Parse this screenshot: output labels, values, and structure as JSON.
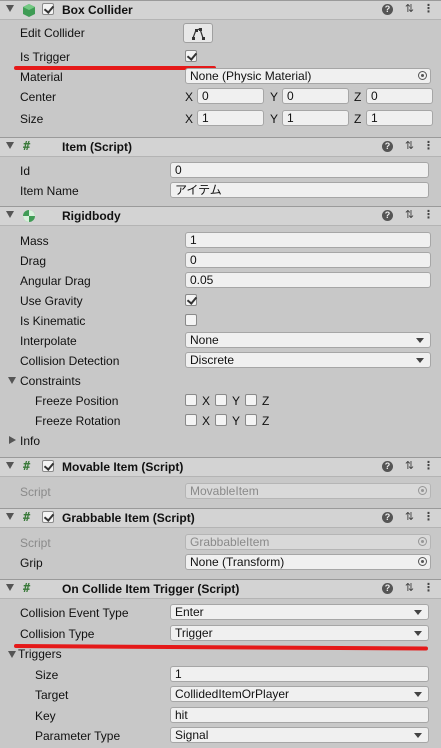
{
  "box_collider": {
    "title": "Box Collider",
    "edit_collider_label": "Edit Collider",
    "is_trigger_label": "Is Trigger",
    "material_label": "Material",
    "material_value": "None (Physic Material)",
    "center_label": "Center",
    "center": {
      "x": "0",
      "y": "0",
      "z": "0"
    },
    "size_label": "Size",
    "size": {
      "x": "1",
      "y": "1",
      "z": "1"
    }
  },
  "axes": {
    "x": "X",
    "y": "Y",
    "z": "Z"
  },
  "item_script": {
    "title": "Item (Script)",
    "id_label": "Id",
    "id_value": "0",
    "item_name_label": "Item Name",
    "item_name_value": "アイテム"
  },
  "rigidbody": {
    "title": "Rigidbody",
    "mass_label": "Mass",
    "mass_value": "1",
    "drag_label": "Drag",
    "drag_value": "0",
    "angular_drag_label": "Angular Drag",
    "angular_drag_value": "0.05",
    "use_gravity_label": "Use Gravity",
    "is_kinematic_label": "Is Kinematic",
    "interpolate_label": "Interpolate",
    "interpolate_value": "None",
    "collision_detection_label": "Collision Detection",
    "collision_detection_value": "Discrete",
    "constraints_label": "Constraints",
    "freeze_position_label": "Freeze Position",
    "freeze_rotation_label": "Freeze Rotation",
    "info_label": "Info"
  },
  "movable_item": {
    "title": "Movable Item (Script)",
    "script_label": "Script",
    "script_value": "MovableItem"
  },
  "grabbable_item": {
    "title": "Grabbable Item (Script)",
    "script_label": "Script",
    "script_value": "GrabbableItem",
    "grip_label": "Grip",
    "grip_value": "None (Transform)"
  },
  "on_collide": {
    "title": "On Collide Item Trigger (Script)",
    "collision_event_type_label": "Collision Event Type",
    "collision_event_type_value": "Enter",
    "collision_type_label": "Collision Type",
    "collision_type_value": "Trigger",
    "triggers_label": "Triggers",
    "size_label": "Size",
    "size_value": "1",
    "target_label": "Target",
    "target_value": "CollidedItemOrPlayer",
    "key_label": "Key",
    "key_value": "hit",
    "parameter_type_label": "Parameter Type",
    "parameter_type_value": "Signal"
  },
  "icons": {
    "help": "?",
    "preset": "⇅",
    "more": "⋮"
  },
  "colors": {
    "highlight": "#e51919"
  }
}
